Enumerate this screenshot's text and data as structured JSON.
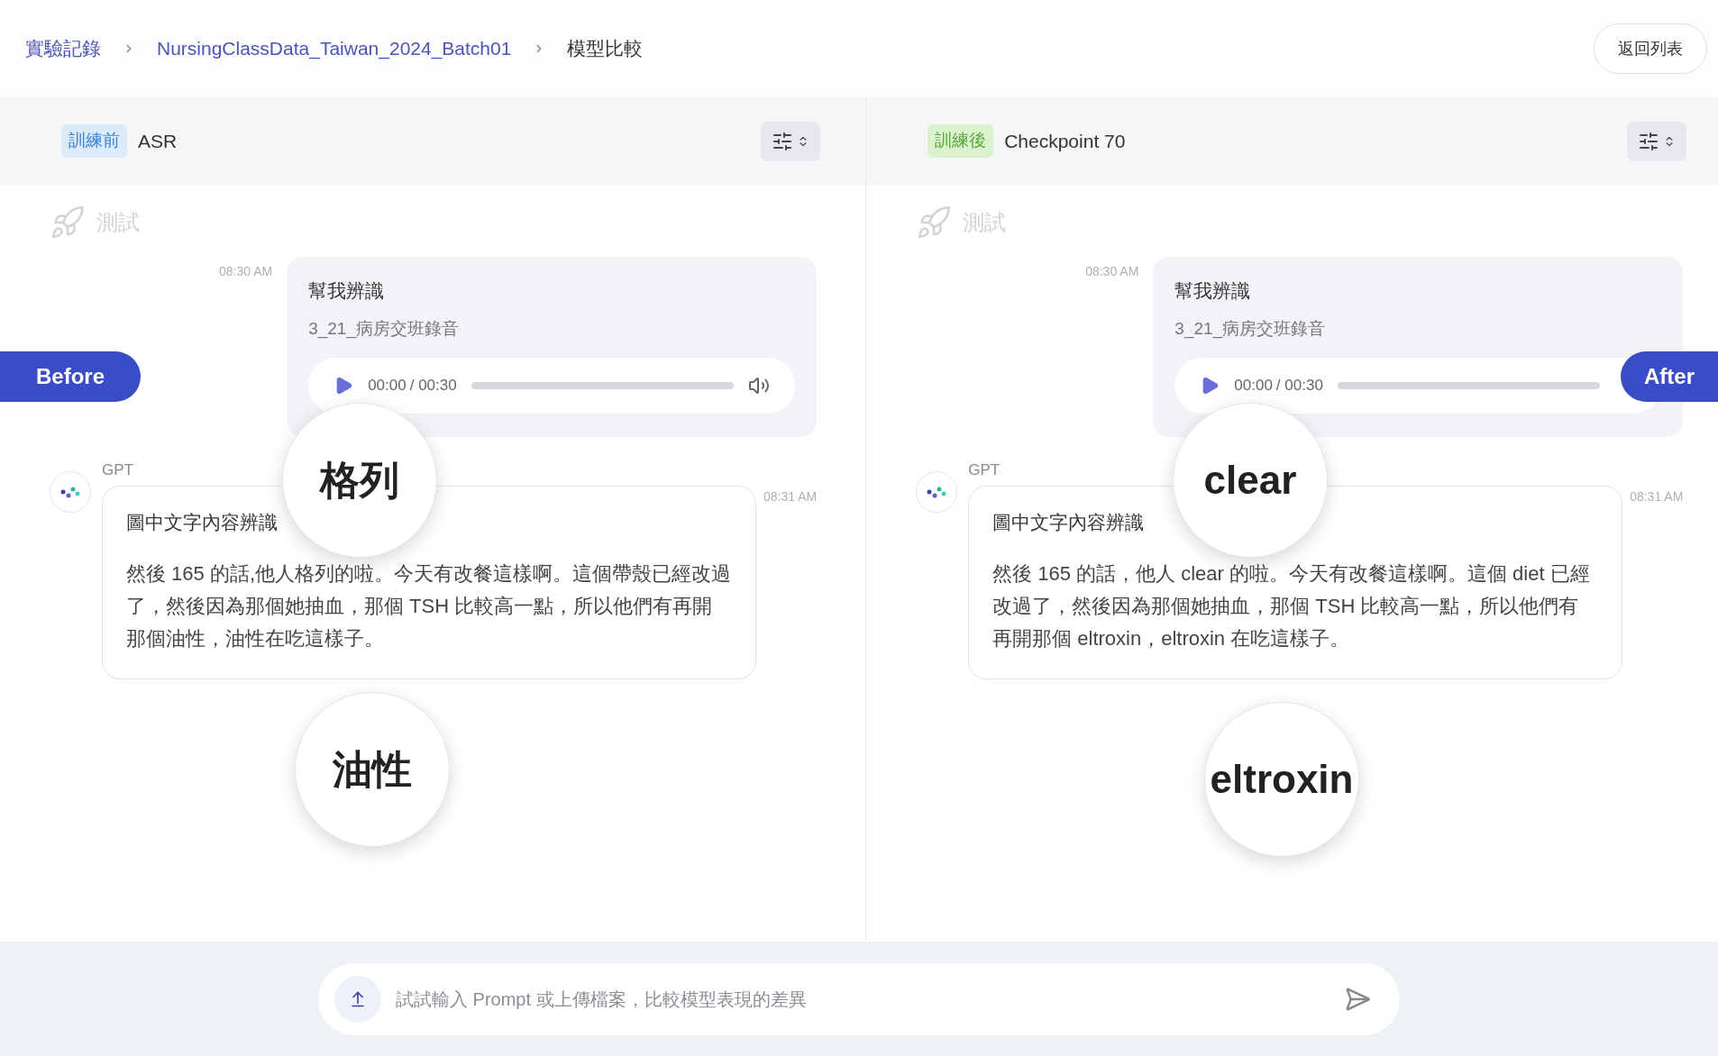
{
  "breadcrumb": [
    {
      "label": "實驗記錄",
      "kind": "link"
    },
    {
      "label": "NursingClassData_Taiwan_2024_Batch01",
      "kind": "link"
    },
    {
      "label": "模型比較",
      "kind": "current"
    }
  ],
  "back_button": "返回列表",
  "panels": [
    {
      "tag": {
        "label": "訓練前",
        "color": "#3b82d6"
      },
      "model": "ASR",
      "flag": "Before",
      "test_label": "測試",
      "user_message": {
        "time": "08:30 AM",
        "title": "幫我辨識",
        "file": "3_21_病房交班錄音",
        "current": "00:00",
        "duration": "/ 00:30"
      },
      "reply": {
        "sender": "GPT",
        "time": "08:31 AM",
        "title": "圖中文字內容辨識",
        "body": "然後 165 的話,他人格列的啦。今天有改餐這樣啊。這個帶殼已經改過了，然後因為那個她抽血，那個 TSH 比較高一點，所以他們有再開那個油性，油性在吃這樣子。"
      },
      "magnifiers": [
        {
          "word": "格列"
        },
        {
          "word": "油性"
        }
      ]
    },
    {
      "tag": {
        "label": "訓練後",
        "color": "#5aa83c"
      },
      "model": "Checkpoint 70",
      "flag": "After",
      "test_label": "測試",
      "user_message": {
        "time": "08:30 AM",
        "title": "幫我辨識",
        "file": "3_21_病房交班錄音",
        "current": "00:00",
        "duration": "/ 00:30"
      },
      "reply": {
        "sender": "GPT",
        "time": "08:31 AM",
        "title": "圖中文字內容辨識",
        "body": "然後 165 的話，他人 clear 的啦。今天有改餐這樣啊。這個 diet 已經改過了，然後因為那個她抽血，那個 TSH 比較高一點，所以他們有再開那個 eltroxin，eltroxin 在吃這樣子。"
      },
      "magnifiers": [
        {
          "word": "clear"
        },
        {
          "word": "eltroxin"
        }
      ]
    }
  ],
  "input": {
    "placeholder": "試試輸入 Prompt 或上傳檔案，比較模型表現的差異"
  }
}
